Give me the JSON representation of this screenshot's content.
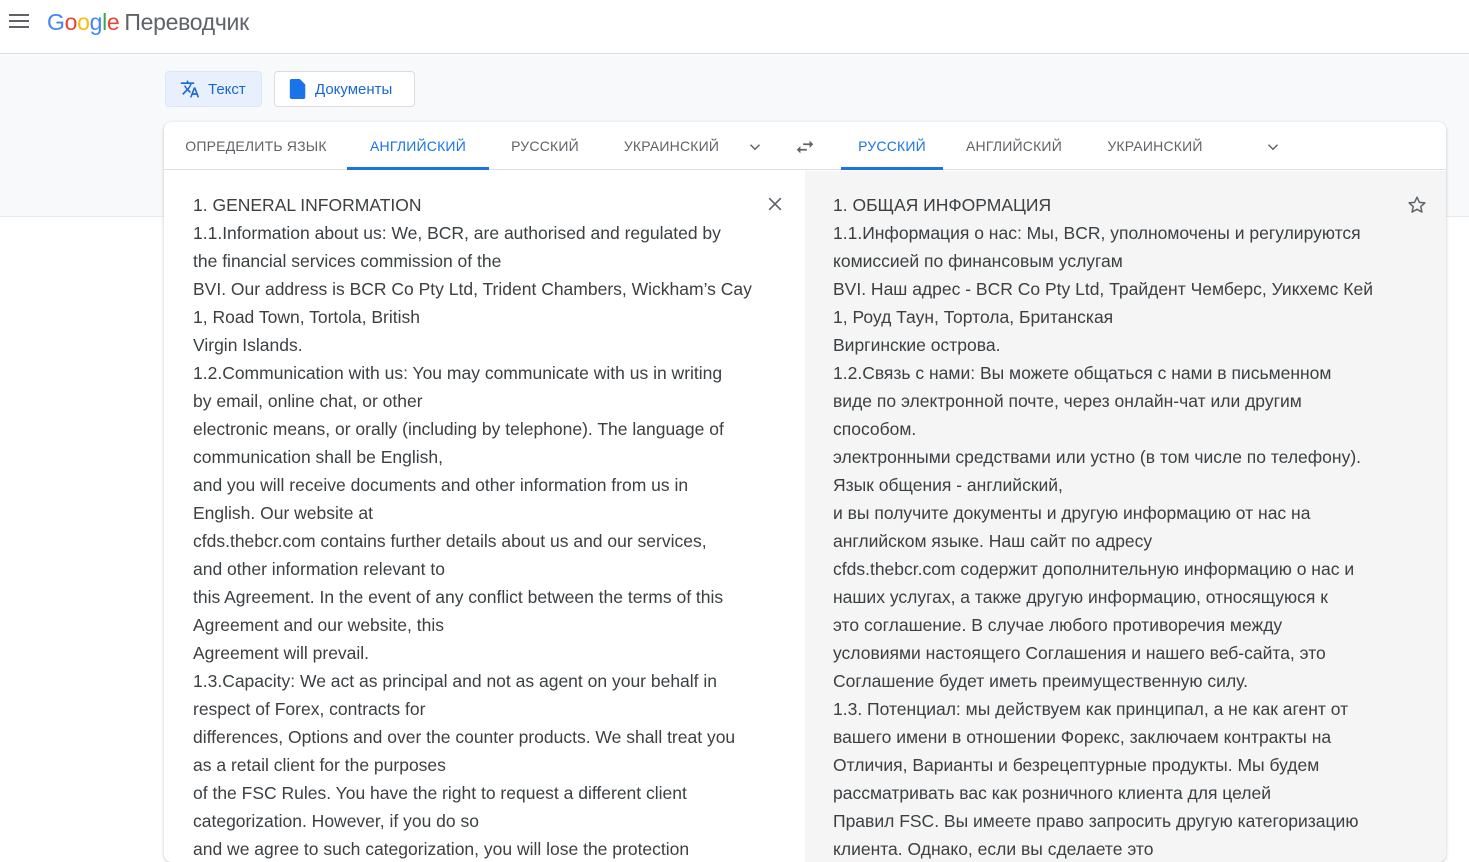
{
  "header": {
    "logo": "Google",
    "product": "Переводчик"
  },
  "modes": {
    "text": "Текст",
    "documents": "Документы"
  },
  "source_tabs": [
    "ОПРЕДЕЛИТЬ ЯЗЫК",
    "АНГЛИЙСКИЙ",
    "РУССКИЙ",
    "УКРАИНСКИЙ"
  ],
  "target_tabs": [
    "РУССКИЙ",
    "АНГЛИЙСКИЙ",
    "УКРАИНСКИЙ"
  ],
  "source_lines": [
    "1. GENERAL INFORMATION",
    "1.1.Information about us: We, BCR, are authorised and regulated by",
    "the financial services commission of the",
    "BVI. Our address is BCR Co Pty Ltd, Trident Chambers, Wickham’s Cay",
    "1, Road Town, Tortola, British",
    "Virgin Islands.",
    "1.2.Communication with us: You may communicate with us in writing",
    "by email, online chat, or other",
    "electronic means, or orally (including by telephone). The language of",
    "communication shall be English,",
    "and you will receive documents and other information from us in",
    "English. Our website at",
    "cfds.thebcr.com contains further details about us and our services,",
    "and other information relevant to",
    "this Agreement. In the event of any conflict between the terms of this",
    "Agreement and our website, this",
    "Agreement will prevail.",
    "1.3.Capacity: We act as principal and not as agent on your behalf in",
    "respect of Forex, contracts for",
    "differences, Options and over the counter products. We shall treat you",
    "as a retail client for the purposes",
    "of the FSC Rules. You have the right to request a different client",
    "categorization. However, if you do so",
    "and we agree to such categorization, you will lose the protection"
  ],
  "target_lines": [
    "1. ОБЩАЯ ИНФОРМАЦИЯ",
    "1.1.Информация о нас: Мы, BCR, уполномочены и регулируются",
    "комиссией по финансовым услугам",
    "BVI. Наш адрес - BCR Co Pty Ltd, Трайдент Чемберс, Уикхемс Кей",
    "1, Роуд Таун, Тортола, Британская",
    "Виргинские острова.",
    "1.2.Связь с нами: Вы можете общаться с нами в письменном",
    "виде по электронной почте, через онлайн-чат или другим",
    "способом.",
    "электронными средствами или устно (в том числе по телефону).",
    "Язык общения - английский,",
    "и вы получите документы и другую информацию от нас на",
    "английском языке. Наш сайт по адресу",
    "cfds.thebcr.com содержит дополнительную информацию о нас и",
    "наших услугах, а также другую информацию, относящуюся к",
    "это соглашение. В случае любого противоречия между",
    "условиями настоящего Соглашения и нашего веб-сайта, это",
    "Соглашение будет иметь преимущественную силу.",
    "1.3. Потенциал: мы действуем как принципал, а не как агент от",
    "вашего имени в отношении Форекс, заключаем контракты на",
    "Отличия, Варианты и безрецептурные продукты. Мы будем",
    "рассматривать вас как розничного клиента для целей",
    "Правил FSC. Вы имеете право запросить другую категоризацию",
    "клиента. Однако, если вы сделаете это"
  ]
}
